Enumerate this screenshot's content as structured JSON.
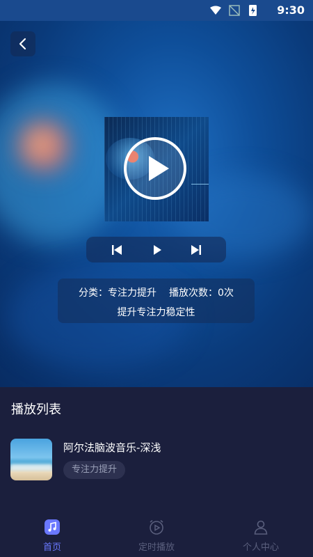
{
  "status_bar": {
    "time": "9:30"
  },
  "player": {
    "category_label": "分类：",
    "category_value": "专注力提升",
    "plays_label": "播放次数：",
    "plays_value": "0次",
    "description": "提升专注力稳定性"
  },
  "playlist": {
    "title": "播放列表",
    "items": [
      {
        "title": "阿尔法脑波音乐-深浅",
        "tag": "专注力提升"
      }
    ]
  },
  "tabbar": {
    "tabs": [
      {
        "label": "首页",
        "active": true
      },
      {
        "label": "定时播放",
        "active": false
      },
      {
        "label": "个人中心",
        "active": false
      }
    ]
  },
  "colors": {
    "accent": "#6a78ff",
    "background": "#1b1f3d",
    "tag_bg": "#2d3150"
  }
}
